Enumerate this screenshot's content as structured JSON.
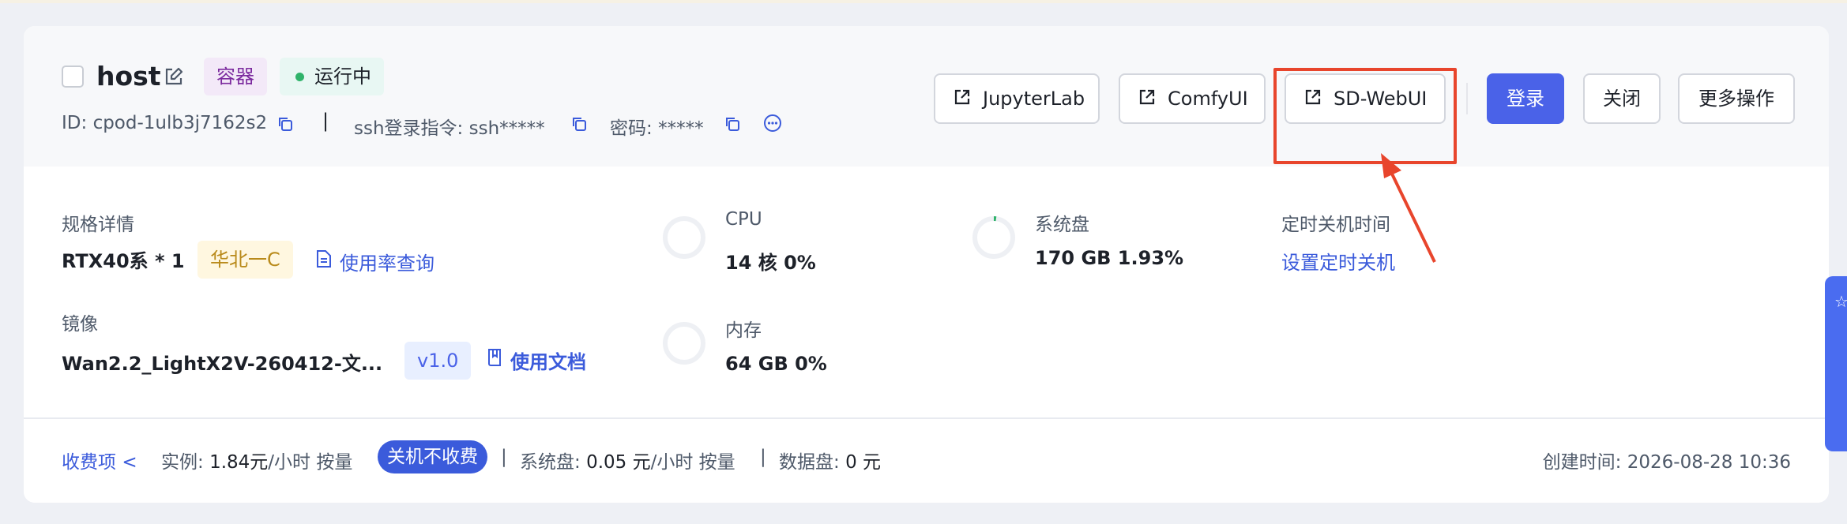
{
  "header": {
    "host_name": "host",
    "tag_type": "容器",
    "status": "运行中",
    "id_label": "ID:",
    "id_value": "cpod-1ulb3j7162s2",
    "separator": "|",
    "ssh_label": "ssh登录指令:",
    "ssh_value": "ssh*****",
    "password_label": "密码:",
    "password_value": "*****",
    "buttons": {
      "jupyter": "JupyterLab",
      "comfy": "ComfyUI",
      "sdwebui": "SD-WebUI",
      "login": "登录",
      "shutdown": "关闭",
      "more": "更多操作"
    }
  },
  "spec": {
    "label": "规格详情",
    "value": "RTX40系 * 1",
    "region": "华北一C",
    "usage_link": "使用率查询"
  },
  "image": {
    "label": "镜像",
    "value": "Wan2.2_LightX2V-260412-文...",
    "version": "v1.0",
    "docs_link": "使用文档"
  },
  "cpu": {
    "label": "CPU",
    "value": "14 核 0%",
    "percent": 0
  },
  "memory": {
    "label": "内存",
    "value": "64 GB 0%",
    "percent": 0
  },
  "disk": {
    "label": "系统盘",
    "value": "170 GB 1.93%",
    "percent": 1.93
  },
  "schedule": {
    "label": "定时关机时间",
    "link": "设置定时关机"
  },
  "footer": {
    "billing_label": "收费项",
    "chevron": "<",
    "instance_label": "实例:",
    "instance_price": "1.84元",
    "instance_unit": "/小时 按量",
    "free_pill": "关机不收费",
    "sep": "|",
    "disk_label": "系统盘:",
    "disk_price": "0.05 元",
    "disk_unit": "/小时 按量",
    "datadisk_label": "数据盘:",
    "datadisk_price": "0 元",
    "created": "创建时间: 2026-08-28 10:36"
  },
  "colors": {
    "primary": "#4a62e8",
    "highlight": "#e8452c",
    "running_dot": "#2fb36a"
  }
}
